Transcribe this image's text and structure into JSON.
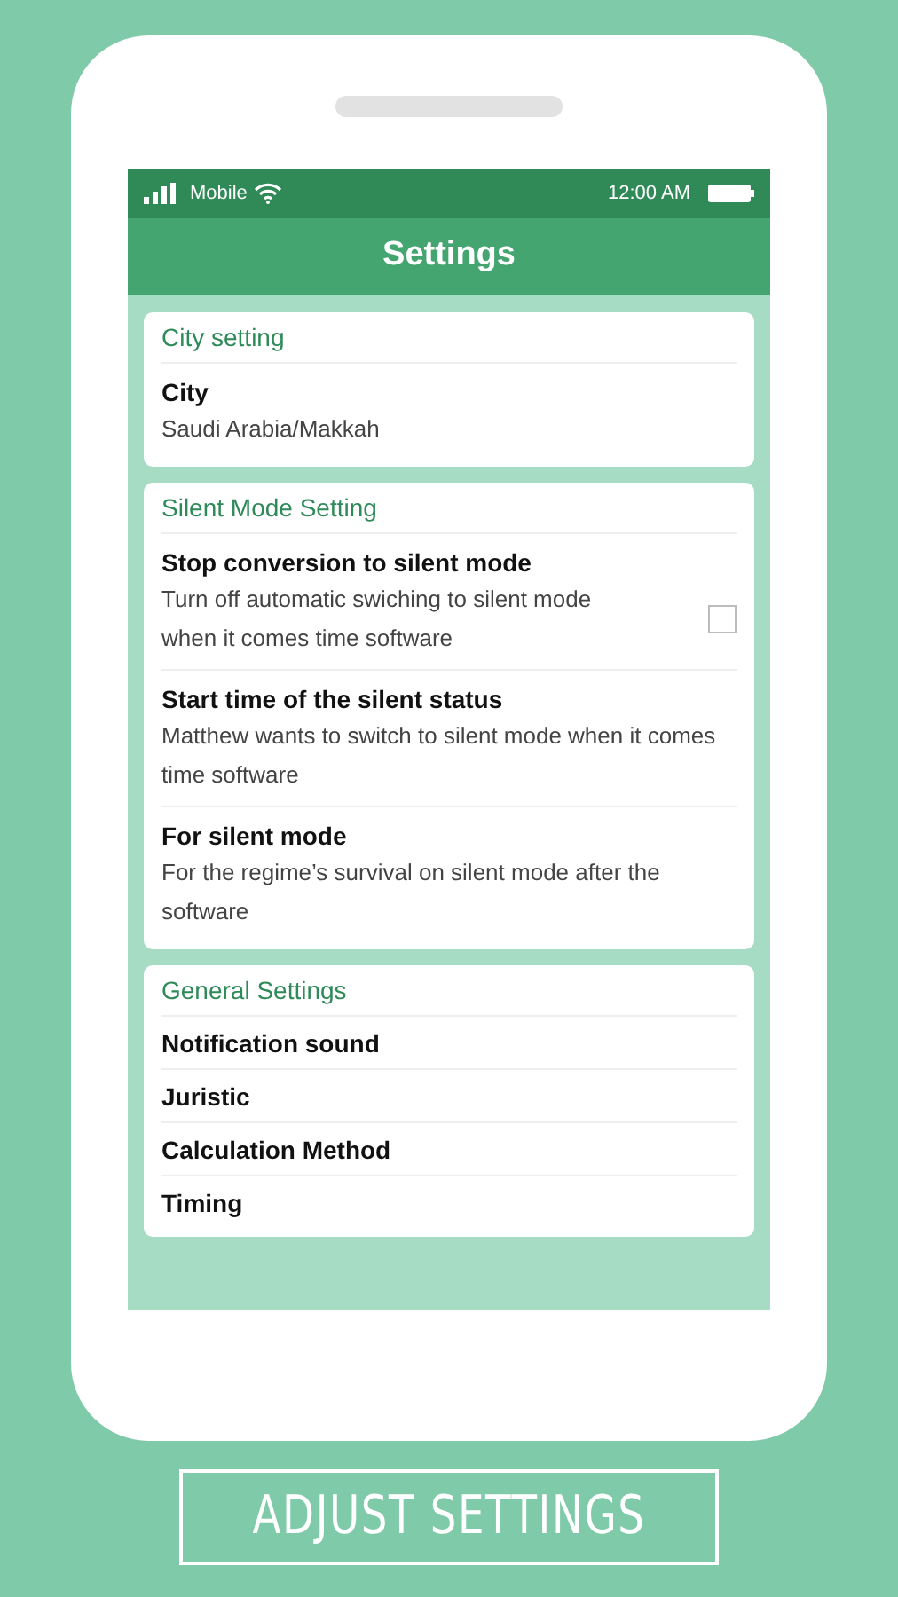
{
  "status_bar": {
    "carrier": "Mobile",
    "time": "12:00 AM"
  },
  "title": "Settings",
  "sections": [
    {
      "header": "City setting",
      "items": [
        {
          "kind": "value",
          "title": "City",
          "description": "Saudi Arabia/Makkah"
        }
      ]
    },
    {
      "header": "Silent Mode Setting",
      "items": [
        {
          "kind": "checkbox",
          "title": "Stop conversion to silent mode",
          "description": "Turn off automatic swiching to silent mode when it comes time software",
          "checked": false
        },
        {
          "kind": "value",
          "title": "Start time of the silent status",
          "description": "Matthew wants to switch to silent mode when it comes time software"
        },
        {
          "kind": "value",
          "title": "For silent mode",
          "description": "For the regime’s survival on silent mode after the software"
        }
      ]
    },
    {
      "header": "General Settings",
      "items": [
        {
          "kind": "link",
          "title": "Notification sound"
        },
        {
          "kind": "link",
          "title": "Juristic"
        },
        {
          "kind": "link",
          "title": "Calculation Method"
        },
        {
          "kind": "link",
          "title": "Timing"
        }
      ]
    }
  ],
  "banner": "ADJUST SETTINGS"
}
